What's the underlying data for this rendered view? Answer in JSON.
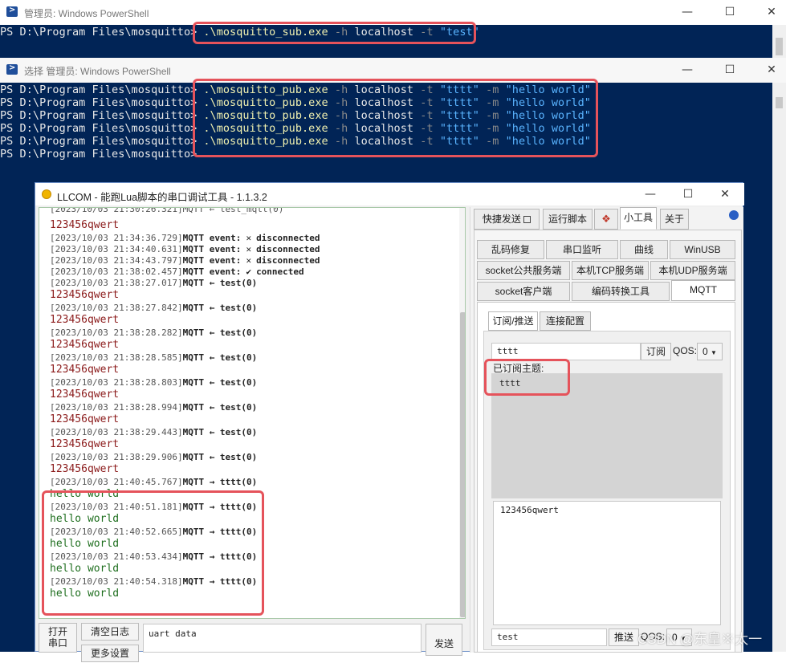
{
  "ps_sub": {
    "title": "管理员: Windows PowerShell",
    "prompt": "PS D:\\Program Files\\mosquitto>",
    "cmd": ".\\mosquitto_sub.exe",
    "flag_h": "-h",
    "host": "localhost",
    "flag_t": "-t",
    "topic": "\"test\""
  },
  "ps_pub": {
    "title": "选择 管理员: Windows PowerShell",
    "prompt": "PS D:\\Program Files\\mosquitto>",
    "cmd": ".\\mosquitto_pub.exe",
    "flag_h": "-h",
    "host": "localhost",
    "flag_t": "-t",
    "topic": "\"tttt\"",
    "flag_m": "-m",
    "message": "\"hello world\""
  },
  "window_buttons": {
    "minimize": "—",
    "maximize": "☐",
    "close": "✕"
  },
  "llcom": {
    "title": "LLCOM - 能跑Lua脚本的串口调试工具 - 1.1.3.2",
    "log": {
      "partial_top": "[2023/10/03 21:30:26.321]MQTT ← test_mqtt(0)",
      "rows": [
        {
          "kind": "red",
          "text": "123456qwert"
        },
        {
          "kind": "evt",
          "ts": "[2023/10/03 21:34:36.729]",
          "tag": "MQTT event:",
          "icon": "✕",
          "status": "disconnected"
        },
        {
          "kind": "evt",
          "ts": "[2023/10/03 21:34:40.631]",
          "tag": "MQTT event:",
          "icon": "✕",
          "status": "disconnected"
        },
        {
          "kind": "evt",
          "ts": "[2023/10/03 21:34:43.797]",
          "tag": "MQTT event:",
          "icon": "✕",
          "status": "disconnected"
        },
        {
          "kind": "evt",
          "ts": "[2023/10/03 21:38:02.457]",
          "tag": "MQTT event:",
          "icon": "✔",
          "status": "connected"
        },
        {
          "kind": "rx",
          "ts": "[2023/10/03 21:38:27.017]",
          "tag": "MQTT ← test(0)"
        },
        {
          "kind": "red",
          "text": "123456qwert"
        },
        {
          "kind": "rx",
          "ts": "[2023/10/03 21:38:27.842]",
          "tag": "MQTT ← test(0)"
        },
        {
          "kind": "red",
          "text": "123456qwert"
        },
        {
          "kind": "rx",
          "ts": "[2023/10/03 21:38:28.282]",
          "tag": "MQTT ← test(0)"
        },
        {
          "kind": "red",
          "text": "123456qwert"
        },
        {
          "kind": "rx",
          "ts": "[2023/10/03 21:38:28.585]",
          "tag": "MQTT ← test(0)"
        },
        {
          "kind": "red",
          "text": "123456qwert"
        },
        {
          "kind": "rx",
          "ts": "[2023/10/03 21:38:28.803]",
          "tag": "MQTT ← test(0)"
        },
        {
          "kind": "red",
          "text": "123456qwert"
        },
        {
          "kind": "rx",
          "ts": "[2023/10/03 21:38:28.994]",
          "tag": "MQTT ← test(0)"
        },
        {
          "kind": "red",
          "text": "123456qwert"
        },
        {
          "kind": "rx",
          "ts": "[2023/10/03 21:38:29.443]",
          "tag": "MQTT ← test(0)"
        },
        {
          "kind": "red",
          "text": "123456qwert"
        },
        {
          "kind": "rx",
          "ts": "[2023/10/03 21:38:29.906]",
          "tag": "MQTT ← test(0)"
        },
        {
          "kind": "red",
          "text": "123456qwert"
        },
        {
          "kind": "rx",
          "ts": "[2023/10/03 21:40:45.767]",
          "tag": "MQTT → tttt(0)"
        },
        {
          "kind": "green",
          "text": "hello world"
        },
        {
          "kind": "rx",
          "ts": "[2023/10/03 21:40:51.181]",
          "tag": "MQTT → tttt(0)"
        },
        {
          "kind": "green",
          "text": "hello world"
        },
        {
          "kind": "rx",
          "ts": "[2023/10/03 21:40:52.665]",
          "tag": "MQTT → tttt(0)"
        },
        {
          "kind": "green",
          "text": "hello world"
        },
        {
          "kind": "rx",
          "ts": "[2023/10/03 21:40:53.434]",
          "tag": "MQTT → tttt(0)"
        },
        {
          "kind": "green",
          "text": "hello world"
        },
        {
          "kind": "rx",
          "ts": "[2023/10/03 21:40:54.318]",
          "tag": "MQTT → tttt(0)"
        },
        {
          "kind": "green",
          "text": "hello world"
        }
      ]
    },
    "bottom": {
      "open_port": "打开\n串口",
      "clear_log": "清空日志",
      "more_settings": "更多设置",
      "uart_data": "uart data",
      "send": "发送"
    },
    "right": {
      "tabs": [
        "快捷发送",
        "运行脚本",
        "",
        "小工具",
        "关于"
      ],
      "tool_tabs_row1": [
        "乱码修复",
        "串口监听",
        "曲线",
        "WinUSB"
      ],
      "tool_tabs_row2": [
        "socket公共服务端",
        "本机TCP服务端",
        "本机UDP服务端"
      ],
      "tool_tabs_row3": [
        "socket客户端",
        "编码转换工具",
        "MQTT"
      ],
      "mqtt_tabs": [
        "订阅/推送",
        "连接配置"
      ],
      "sub_topic_value": "tttt",
      "subscribe_btn": "订阅",
      "qos_label": "QOS:",
      "qos_value": "0",
      "subscribed_label": "已订阅主题:",
      "subscribed_item": "tttt",
      "payload": "123456qwert",
      "pub_topic_value": "test",
      "publish_btn": "推送",
      "pub_qos_label": "QOS:",
      "pub_qos_value": "0"
    }
  },
  "watermark": "CSDN @东皇※太一"
}
